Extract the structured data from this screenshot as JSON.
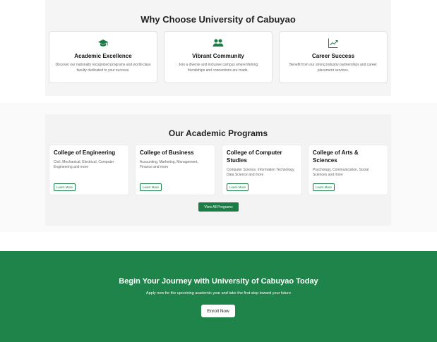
{
  "why": {
    "title": "Why Choose University of Cabuyao",
    "features": [
      {
        "icon": "graduation-cap-icon",
        "title": "Academic Excellence",
        "desc": "Discover our nationally recognized programs and world-class faculty dedicated to your success."
      },
      {
        "icon": "users-icon",
        "title": "Vibrant Community",
        "desc": "Join a diverse and inclusive campus where lifelong friendships and connections are made."
      },
      {
        "icon": "chart-line-icon",
        "title": "Career Success",
        "desc": "Benefit from our strong industry partnerships and career placement services."
      }
    ]
  },
  "programs": {
    "title": "Our Academic Programs",
    "cards": [
      {
        "title": "College of Engineering",
        "desc": "Civil, Mechanical, Electrical, Computer Engineering and more",
        "link": "Learn More"
      },
      {
        "title": "College of Business",
        "desc": "Accounting, Marketing, Management, Finance and more",
        "link": "Learn More"
      },
      {
        "title": "College of Computer Studies",
        "desc": "Computer Science, Information Technology, Data Science and more",
        "link": "Learn More"
      },
      {
        "title": "College of Arts & Sciences",
        "desc": "Psychology, Communication, Social Sciences and more",
        "link": "Learn More"
      }
    ],
    "view_all": "View All Programs"
  },
  "cta": {
    "title": "Begin Your Journey with University of Cabuyao Today",
    "subtitle": "Apply now for the upcoming academic year and take the first step toward your future",
    "button": "Enroll Now"
  },
  "colors": {
    "accent": "#1a7d46",
    "cta_bg": "#1e8449"
  }
}
